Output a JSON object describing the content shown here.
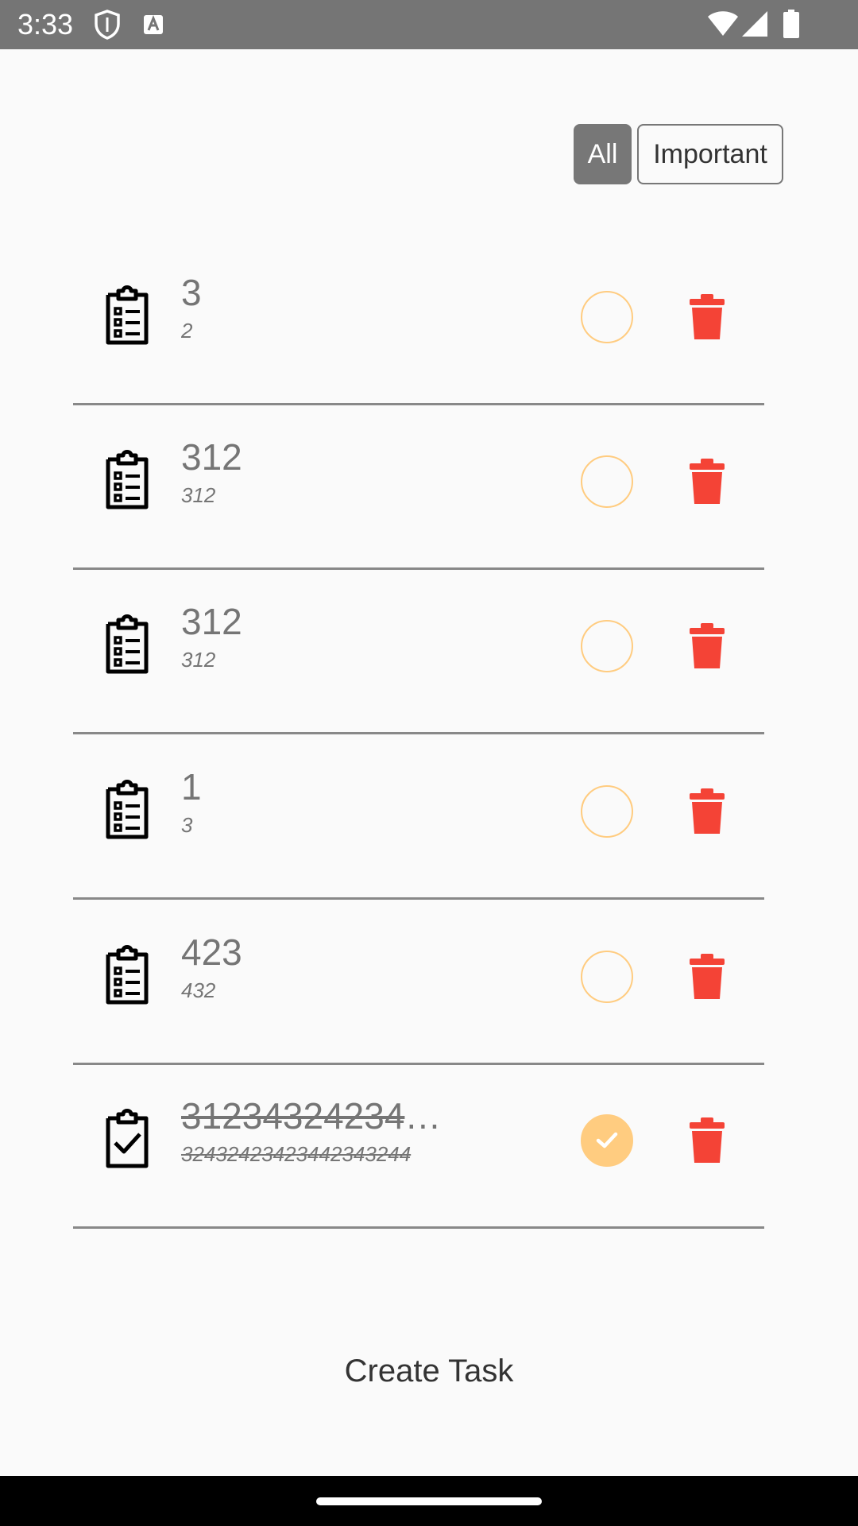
{
  "status_bar": {
    "time": "3:33"
  },
  "filters": {
    "all_label": "All",
    "important_label": "Important"
  },
  "tasks": [
    {
      "title": "3",
      "subtitle": "2",
      "done": false
    },
    {
      "title": "312",
      "subtitle": "312",
      "done": false
    },
    {
      "title": "312",
      "subtitle": "312",
      "done": false
    },
    {
      "title": "1",
      "subtitle": "3",
      "done": false
    },
    {
      "title": "423",
      "subtitle": "432",
      "done": false
    },
    {
      "title": "312343242343…",
      "subtitle": "32432423423442343244",
      "done": true
    }
  ],
  "create_task_label": "Create Task",
  "colors": {
    "accent": "#ffcc80",
    "delete": "#f44336",
    "filter_active": "#777777",
    "text_muted": "#757575"
  },
  "icons": {
    "task": "clipboard-list-icon",
    "task_done": "clipboard-check-icon",
    "complete": "circle-check-icon",
    "delete": "trash-icon"
  }
}
